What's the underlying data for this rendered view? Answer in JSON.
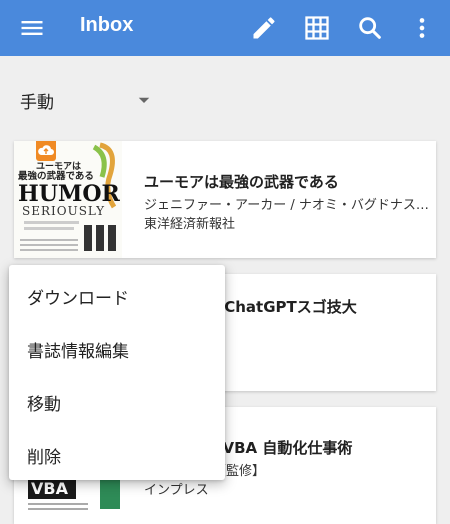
{
  "appbar": {
    "title": "Inbox",
    "background": "#4a89dc",
    "icons": [
      "menu-icon",
      "edit-icon",
      "grid-icon",
      "search-icon",
      "more-vert-icon"
    ]
  },
  "sort": {
    "label": "手動"
  },
  "books": [
    {
      "title": "ユーモアは最強の武器である",
      "authors": "ジェニファー・アーカー / ナオミ・バグドナス…",
      "publisher": "東洋経済新報社",
      "cover_text": [
        "ユーモアは",
        "最強の武器である",
        "HUMOR",
        "SERIOUSLY"
      ],
      "badge": "cloud-upload-icon"
    },
    {
      "title": "果が出る！ ChatGPTスゴ技大"
    },
    {
      "title": "PI×Excel VBA 自動化仕事術",
      "authors": "| / 古川渉一【監修】",
      "publisher": "インプレス",
      "cover_text": [
        "VBA"
      ]
    }
  ],
  "context_menu": {
    "items": [
      "ダウンロード",
      "書誌情報編集",
      "移動",
      "削除"
    ]
  }
}
